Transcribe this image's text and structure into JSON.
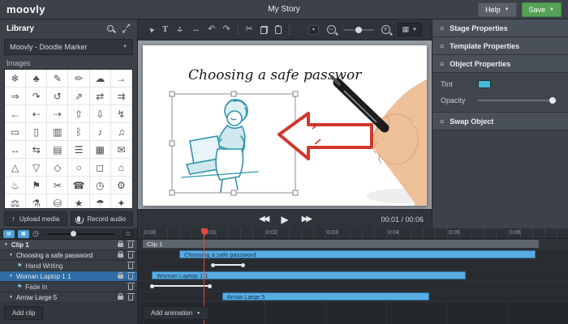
{
  "topbar": {
    "logo": "moovly",
    "title": "My Story",
    "help_label": "Help",
    "save_label": "Save"
  },
  "library": {
    "title": "Library",
    "collection": "Moovly - Doodle Marker",
    "section_label": "Images",
    "upload_label": "Upload media",
    "record_label": "Record audio",
    "grid_icons": [
      "❄",
      "♣",
      "✎",
      "✏",
      "☁",
      "→",
      "⇒",
      "↷",
      "↺",
      "⇗",
      "⇄",
      "⇉",
      "←",
      "⇠",
      "⇢",
      "⇧",
      "⇩",
      "↯",
      "▭",
      "▯",
      "▥",
      "ᛒ",
      "♪",
      "♫",
      "↔",
      "⇆",
      "▤",
      "☰",
      "▦",
      "✉",
      "△",
      "▽",
      "◇",
      "○",
      "◻",
      "⌂",
      "♨",
      "⚑",
      "✂",
      "☎",
      "◷",
      "⚙",
      "⚖",
      "⚗",
      "⛁",
      "★",
      "☂",
      "✦"
    ]
  },
  "toolbar": {
    "items": [
      {
        "name": "select-tool",
        "glyph": "►"
      },
      {
        "name": "text-tool",
        "glyph": "T"
      },
      {
        "name": "move-tool",
        "glyph": ""
      },
      {
        "name": "stretch-tool",
        "glyph": "↔"
      },
      {
        "name": "undo",
        "glyph": "↶"
      },
      {
        "name": "redo",
        "glyph": "↷"
      },
      {
        "name": "sep"
      },
      {
        "name": "cut",
        "glyph": "✂"
      },
      {
        "name": "copy",
        "glyph": ""
      },
      {
        "name": "paste",
        "glyph": ""
      },
      {
        "name": "sep"
      },
      {
        "name": "more-dropdown",
        "glyph": "▾"
      },
      {
        "name": "zoom-out",
        "glyph": "−"
      },
      {
        "name": "zoom-slider"
      },
      {
        "name": "zoom-in",
        "glyph": "+"
      },
      {
        "name": "grid-view",
        "glyph": "▦"
      }
    ]
  },
  "canvas": {
    "headline": "Choosing a safe passwor",
    "time_display": "00:01 / 00:06"
  },
  "properties": {
    "sections": [
      "Stage Properties",
      "Template Properties",
      "Object Properties",
      "Swap Object"
    ],
    "tint_label": "Tint",
    "tint_color": "#41b9da",
    "opacity_label": "Opacity"
  },
  "timeline": {
    "ruler_labels": [
      "0:00",
      "0:01",
      "0:02",
      "0:03",
      "0:04",
      "0:05",
      "0:06"
    ],
    "playhead_seconds": 1.0,
    "layers": [
      {
        "name": "Clip 1",
        "kind": "clip",
        "caret": true,
        "lock": true,
        "trash": true
      },
      {
        "name": "Choosing a safe password",
        "kind": "object",
        "caret": true,
        "lock": true,
        "trash": true
      },
      {
        "name": "Hand Writing",
        "kind": "animation",
        "trash": true
      },
      {
        "name": "Woman Laptop 1 1",
        "kind": "object",
        "caret": true,
        "lock": true,
        "trash": true,
        "selected": true
      },
      {
        "name": "Fade In",
        "kind": "animation",
        "trash": true
      },
      {
        "name": "Arrow Large 5",
        "kind": "object",
        "caret": true,
        "lock": true,
        "trash": true
      }
    ],
    "bars": [
      {
        "row": 0,
        "type": "clip",
        "label": "Clip 1",
        "start": 0,
        "end": 6.5
      },
      {
        "row": 1,
        "type": "object",
        "label": "Choosing a safe password",
        "start": 0.6,
        "end": 6.45
      },
      {
        "row": 2,
        "type": "animation",
        "label": "",
        "start": 1.15,
        "end": 1.65
      },
      {
        "row": 3,
        "type": "object",
        "label": "Woman Laptop 1 1",
        "start": 0.15,
        "end": 5.3
      },
      {
        "row": 4,
        "type": "animation",
        "label": "",
        "start": 0.15,
        "end": 1.1
      },
      {
        "row": 5,
        "type": "object",
        "label": "Arrow Large 5",
        "start": 1.3,
        "end": 4.7
      }
    ],
    "add_clip_label": "Add clip",
    "add_animation_label": "Add animation"
  }
}
